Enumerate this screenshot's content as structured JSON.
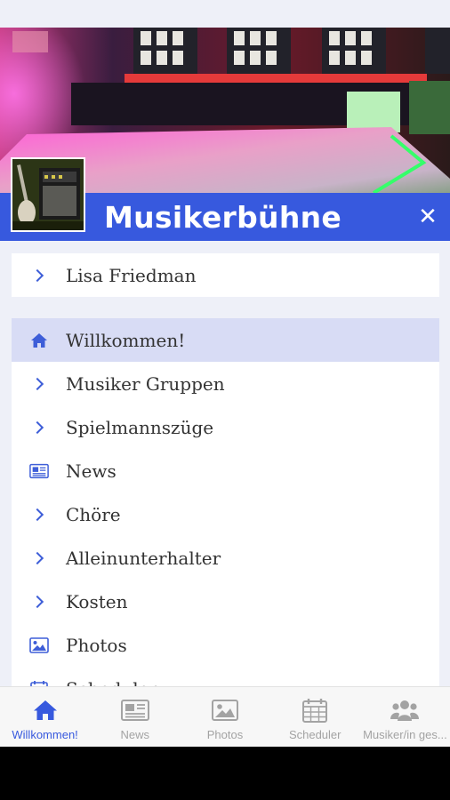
{
  "header": {
    "app_title": "Musikerbühne",
    "close_label": "✕"
  },
  "user": {
    "name": "Lisa Friedman"
  },
  "menu": {
    "items": [
      {
        "label": "Willkommen!",
        "icon": "home-icon",
        "active": true
      },
      {
        "label": "Musiker Gruppen",
        "icon": "chevron-right-icon",
        "active": false
      },
      {
        "label": "Spielmannszüge",
        "icon": "chevron-right-icon",
        "active": false
      },
      {
        "label": "News",
        "icon": "newspaper-icon",
        "active": false
      },
      {
        "label": "Chöre",
        "icon": "chevron-right-icon",
        "active": false
      },
      {
        "label": "Alleinunterhalter",
        "icon": "chevron-right-icon",
        "active": false
      },
      {
        "label": "Kosten",
        "icon": "chevron-right-icon",
        "active": false
      },
      {
        "label": "Photos",
        "icon": "image-icon",
        "active": false
      },
      {
        "label": "Scheduler",
        "icon": "calendar-icon",
        "active": false
      }
    ]
  },
  "bottom_nav": {
    "tabs": [
      {
        "label": "Willkommen!",
        "icon": "home-icon",
        "active": true
      },
      {
        "label": "News",
        "icon": "newspaper-icon",
        "active": false
      },
      {
        "label": "Photos",
        "icon": "image-icon",
        "active": false
      },
      {
        "label": "Scheduler",
        "icon": "calendar-icon",
        "active": false
      },
      {
        "label": "Musiker/in ges...",
        "icon": "users-icon",
        "active": false
      }
    ]
  },
  "colors": {
    "accent": "#3759de",
    "active_row": "#d8dcf5",
    "inactive_nav": "#a3a3a3",
    "background": "#eef0f8"
  }
}
